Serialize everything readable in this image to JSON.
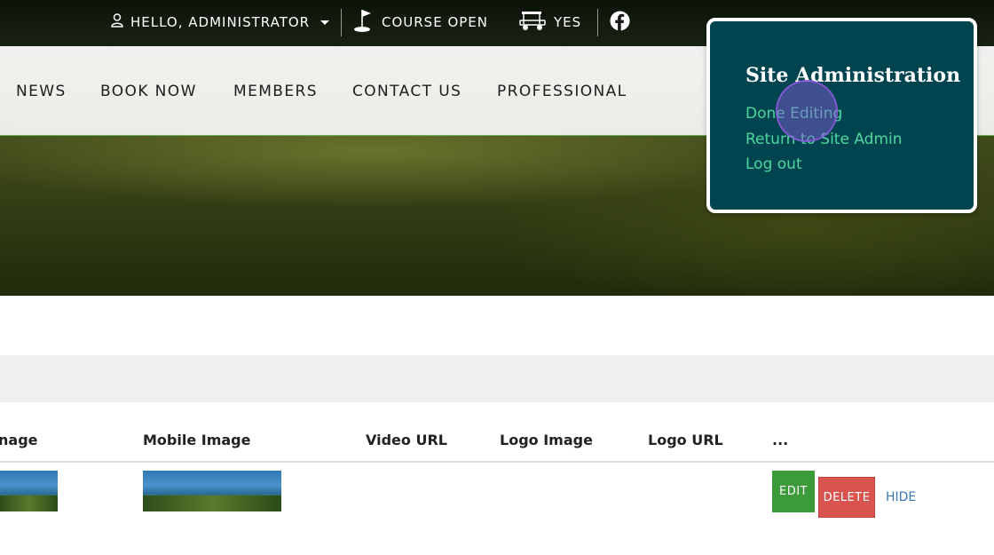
{
  "topbar": {
    "greeting": "HELLO, ADMINISTRATOR",
    "course_status": "COURSE OPEN",
    "cart_status": "YES"
  },
  "nav": {
    "items": [
      "NEWS",
      "BOOK NOW",
      "MEMBERS",
      "CONTACT US",
      "PROFESSIONAL"
    ]
  },
  "admin_panel": {
    "title": "Site Administration",
    "links": [
      "Done Editing",
      "Return to Site Admin",
      "Log out"
    ]
  },
  "table": {
    "headers": [
      "nage",
      "Mobile Image",
      "Video URL",
      "Logo Image",
      "Logo URL",
      "..."
    ],
    "row_actions": {
      "edit": "EDIT",
      "delete": "DELETE",
      "hide": "HIDE"
    }
  },
  "colors": {
    "admin_bg": "#004450",
    "admin_link": "#4fd6a0",
    "edit_button": "#3d9a3a",
    "delete_button": "#d9534f",
    "hide_link": "#3a79b8"
  },
  "icons": [
    "user-icon",
    "caret-down-icon",
    "golf-flag-icon",
    "golf-cart-icon",
    "facebook-icon"
  ]
}
